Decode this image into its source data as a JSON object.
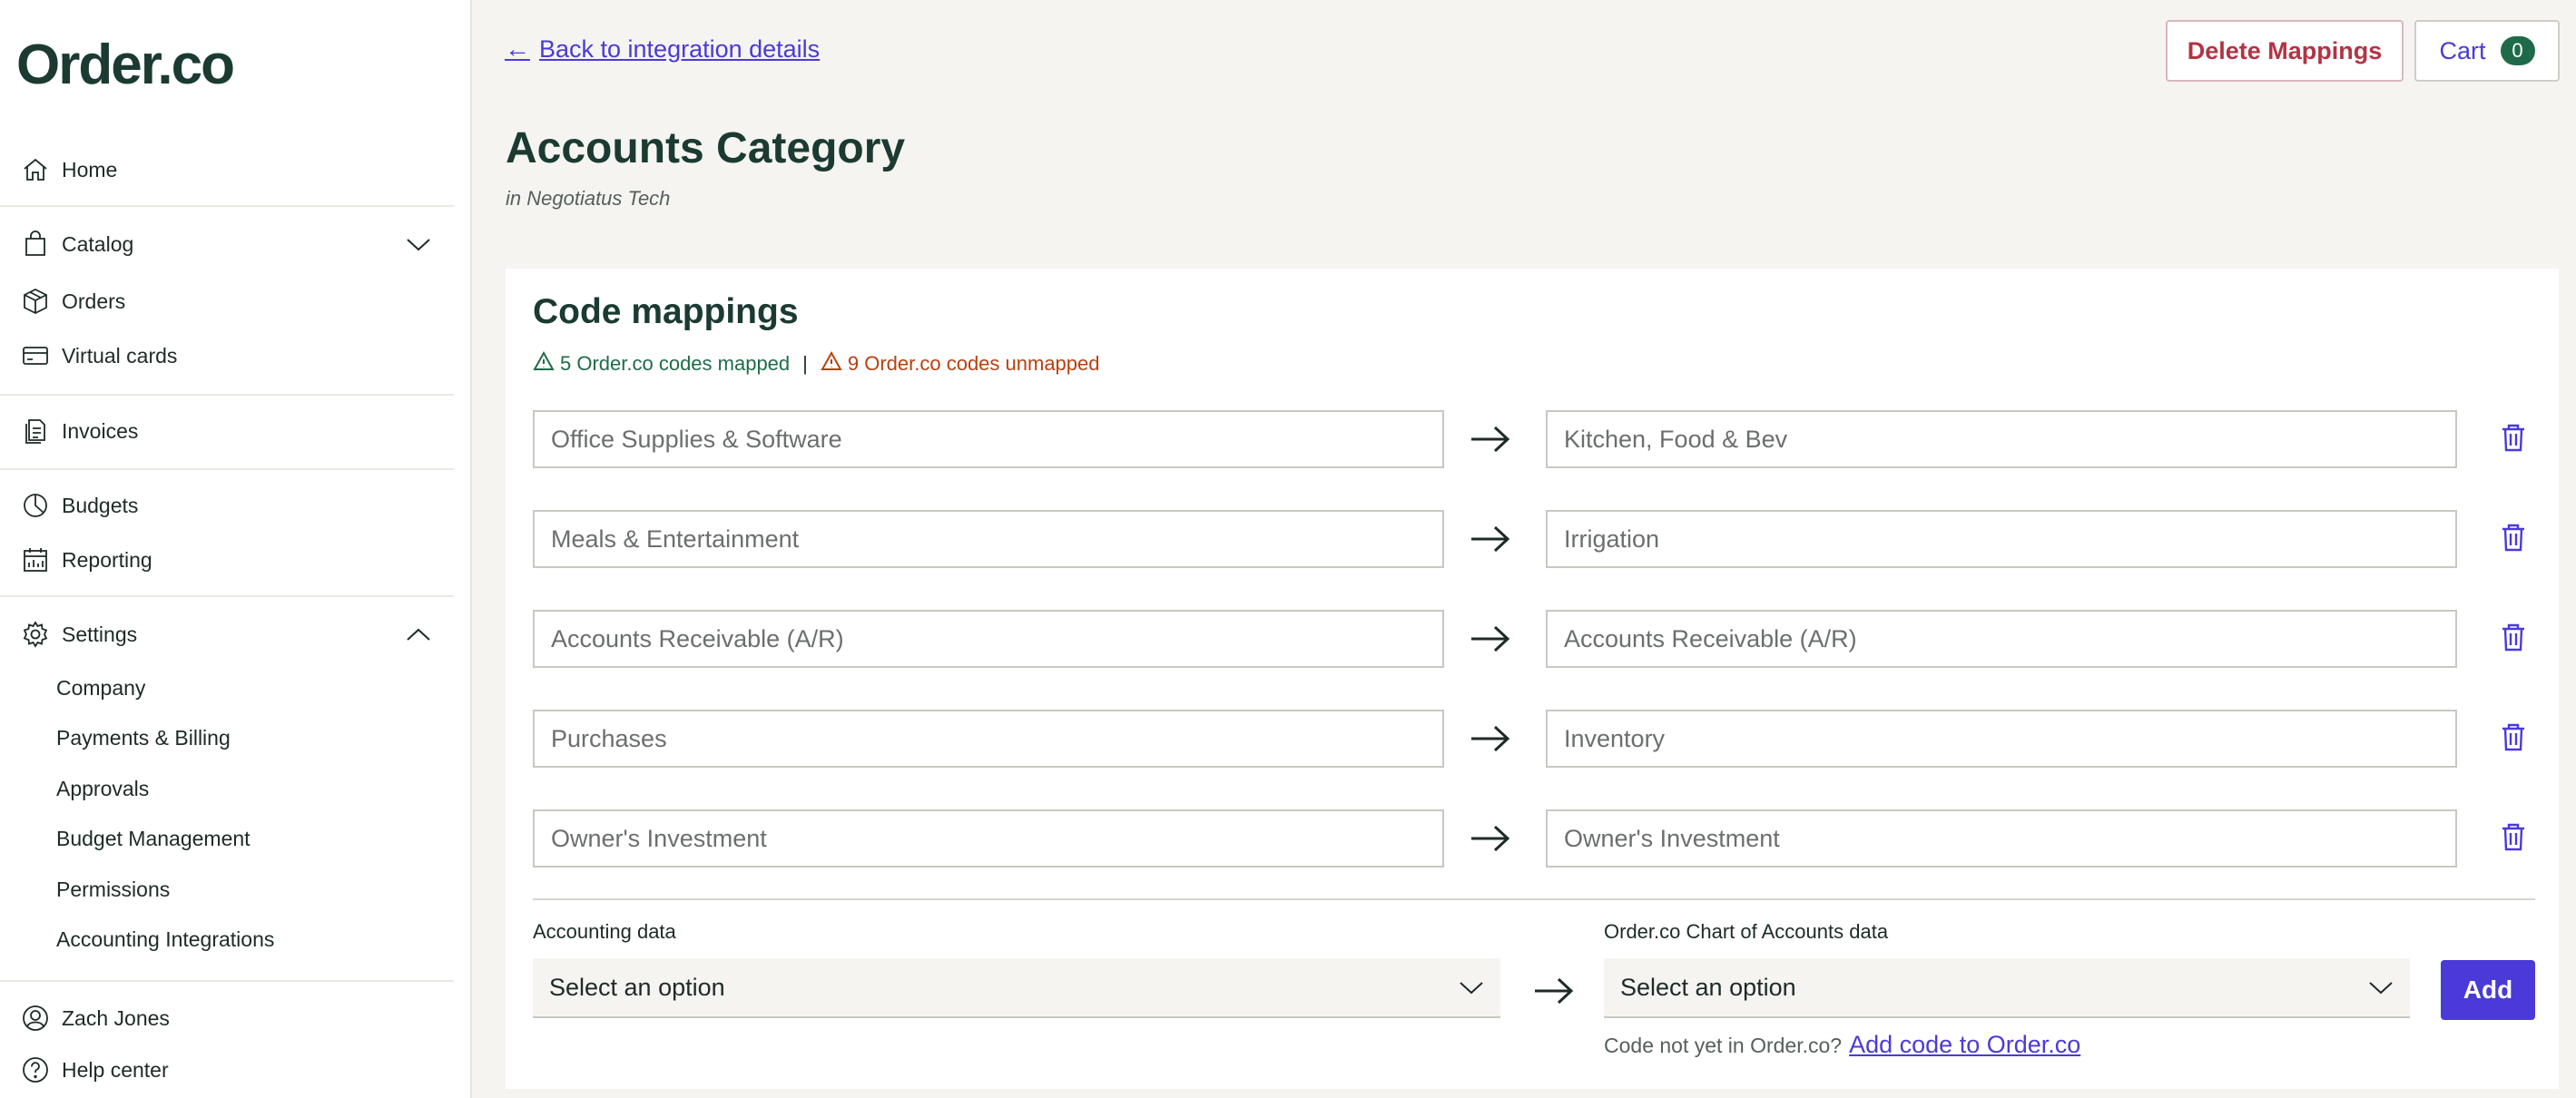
{
  "brand": {
    "logo": "Order.co"
  },
  "sidebar": {
    "items": [
      {
        "id": "home",
        "label": "Home"
      },
      {
        "id": "catalog",
        "label": "Catalog"
      },
      {
        "id": "orders",
        "label": "Orders"
      },
      {
        "id": "virtual-cards",
        "label": "Virtual cards"
      },
      {
        "id": "invoices",
        "label": "Invoices"
      },
      {
        "id": "budgets",
        "label": "Budgets"
      },
      {
        "id": "reporting",
        "label": "Reporting"
      },
      {
        "id": "settings",
        "label": "Settings"
      }
    ],
    "settings_sub": [
      "Company",
      "Payments & Billing",
      "Approvals",
      "Budget Management",
      "Permissions",
      "Accounting Integrations"
    ],
    "user": {
      "name": "Zach Jones"
    },
    "help": {
      "label": "Help center"
    }
  },
  "topbar": {
    "back_label": "Back to integration details",
    "delete_label": "Delete Mappings",
    "cart_label": "Cart",
    "cart_count": "0"
  },
  "page": {
    "title": "Accounts Category",
    "subtitle": "in Negotiatus Tech"
  },
  "mappings": {
    "title": "Code mappings",
    "mapped_text": "5 Order.co codes mapped",
    "separator": "|",
    "unmapped_text": "9 Order.co codes unmapped",
    "rows": [
      {
        "left": "Office Supplies & Software",
        "right": "Kitchen, Food & Bev"
      },
      {
        "left": "Meals & Entertainment",
        "right": "Irrigation"
      },
      {
        "left": "Accounts Receivable (A/R)",
        "right": "Accounts Receivable (A/R)"
      },
      {
        "left": "Purchases",
        "right": "Inventory"
      },
      {
        "left": "Owner's Investment",
        "right": "Owner's Investment"
      }
    ],
    "new": {
      "left_label": "Accounting data",
      "left_value": "Select an option",
      "right_label": "Order.co Chart of Accounts data",
      "right_value": "Select an option",
      "add_label": "Add",
      "hint_text": "Code not yet in Order.co?",
      "hint_link": "Add code to Order.co"
    }
  },
  "colors": {
    "accent": "#4a3ad8",
    "brand_green": "#1b3a32",
    "success": "#1f6b49",
    "warning": "#b8400f",
    "danger": "#b23444"
  }
}
